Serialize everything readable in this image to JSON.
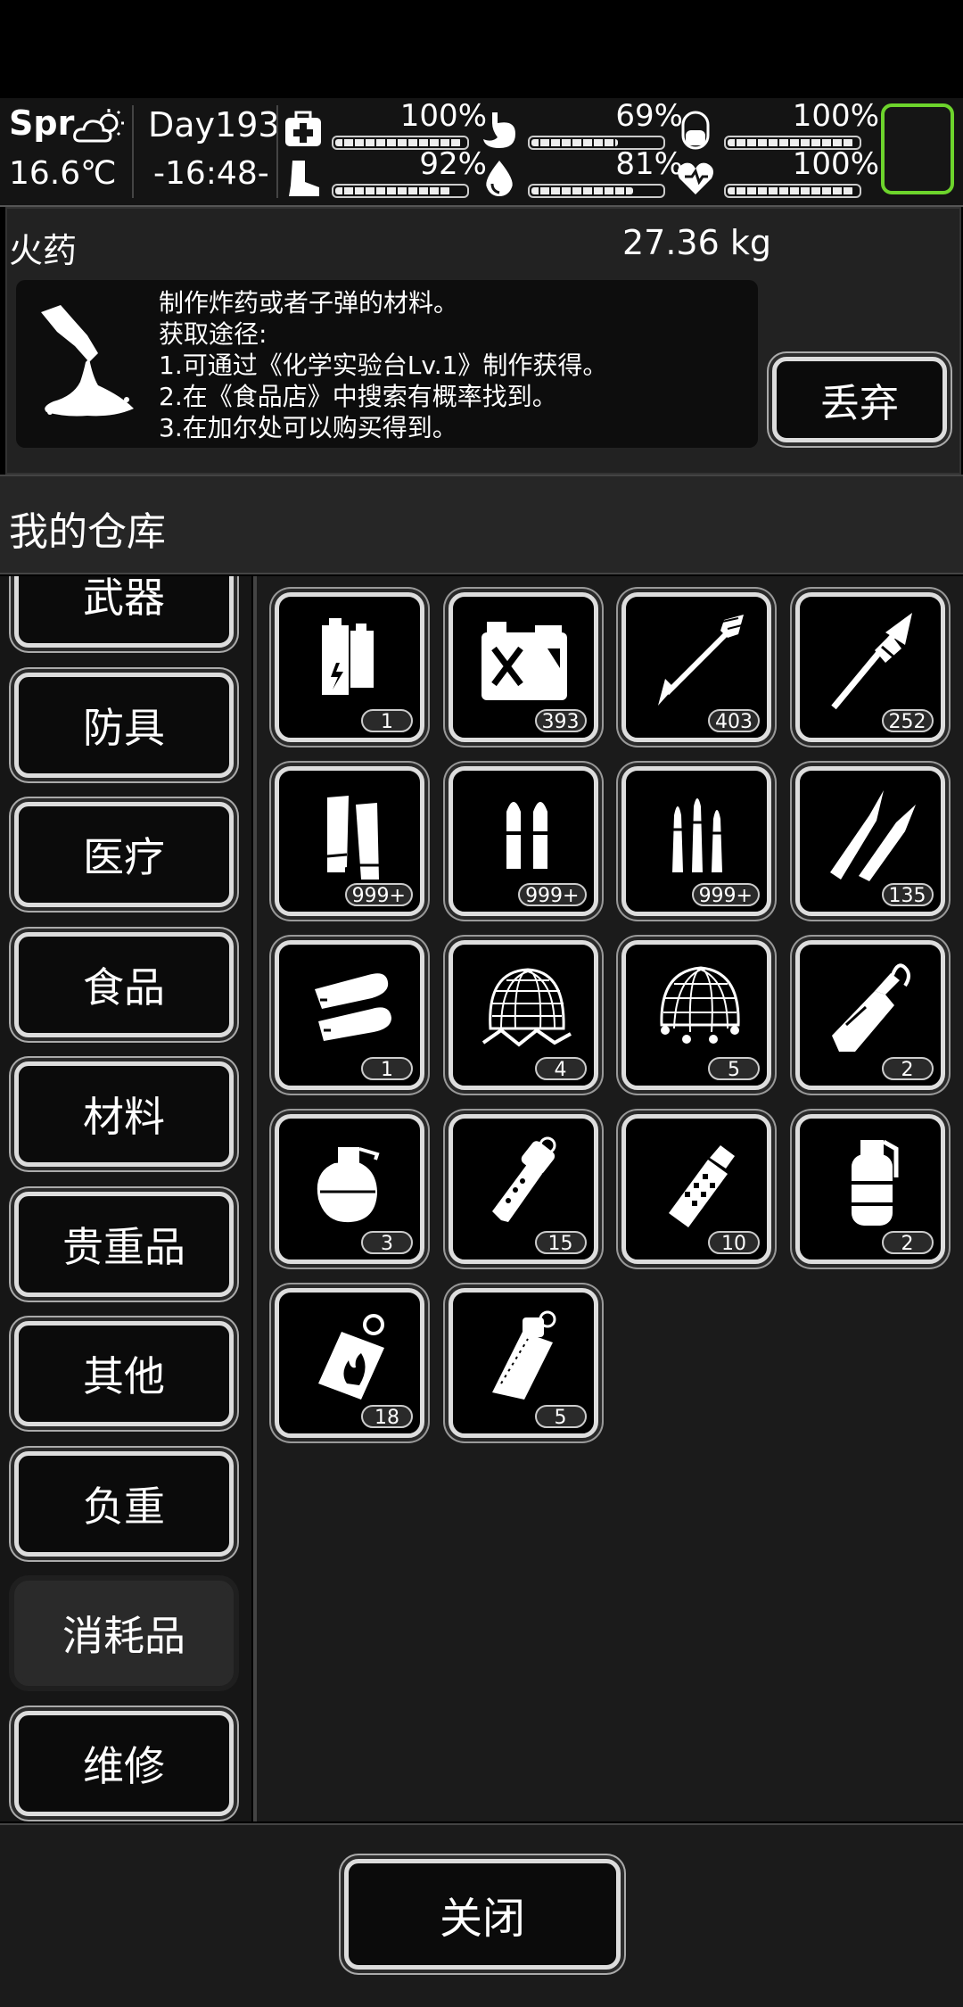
{
  "hud": {
    "season": "Spr",
    "weather_icon": "partly-cloudy-icon",
    "temperature": "16.6℃",
    "day": "Day193",
    "time": "-16:48-",
    "stats": [
      {
        "name": "health",
        "icon": "medkit-icon",
        "value": "100%",
        "level": 1.0
      },
      {
        "name": "hunger",
        "icon": "stomach-icon",
        "value": "69%",
        "level": 0.69
      },
      {
        "name": "energy",
        "icon": "capsule-icon",
        "value": "100%",
        "level": 1.0
      },
      {
        "name": "stamina",
        "icon": "boot-icon",
        "value": "92%",
        "level": 0.92
      },
      {
        "name": "thirst",
        "icon": "water-drop-icon",
        "value": "81%",
        "level": 0.81
      },
      {
        "name": "mood",
        "icon": "heart-icon",
        "value": "100%",
        "level": 1.0
      }
    ],
    "slot_color": "#6dd42c"
  },
  "item": {
    "name": "火药",
    "weight": "27.36 kg",
    "description": [
      "制作炸药或者子弹的材料。",
      "获取途径:",
      "1.可通过《化学实验台Lv.1》制作获得。",
      "2.在《食品店》中搜索有概率找到。",
      "3.在加尔处可以购买得到。"
    ],
    "drop_label": "丢弃"
  },
  "warehouse": {
    "title": "我的仓库",
    "categories": [
      "武器",
      "防具",
      "医疗",
      "食品",
      "材料",
      "贵重品",
      "其他",
      "负重",
      "消耗品",
      "维修"
    ],
    "active_category": "消耗品",
    "items": [
      {
        "icon": "battery-icon",
        "qty": "1"
      },
      {
        "icon": "jerry-can-icon",
        "qty": "393"
      },
      {
        "icon": "arrow-icon",
        "qty": "403"
      },
      {
        "icon": "rocket-icon",
        "qty": "252"
      },
      {
        "icon": "shotgun-shell-icon",
        "qty": "999+"
      },
      {
        "icon": "pistol-ammo-icon",
        "qty": "999+"
      },
      {
        "icon": "rifle-ammo-icon",
        "qty": "999+"
      },
      {
        "icon": "sniper-ammo-icon",
        "qty": "135"
      },
      {
        "icon": "grenade-round-icon",
        "qty": "1"
      },
      {
        "icon": "net-trap-icon",
        "qty": "4"
      },
      {
        "icon": "throw-net-icon",
        "qty": "5"
      },
      {
        "icon": "molotov-icon",
        "qty": "2"
      },
      {
        "icon": "frag-grenade-icon",
        "qty": "3"
      },
      {
        "icon": "flashbang-icon",
        "qty": "15"
      },
      {
        "icon": "stun-grenade-icon",
        "qty": "10"
      },
      {
        "icon": "smoke-grenade-icon",
        "qty": "2"
      },
      {
        "icon": "incendiary-icon",
        "qty": "18"
      },
      {
        "icon": "sticky-bomb-icon",
        "qty": "5"
      }
    ]
  },
  "close_label": "关闭"
}
